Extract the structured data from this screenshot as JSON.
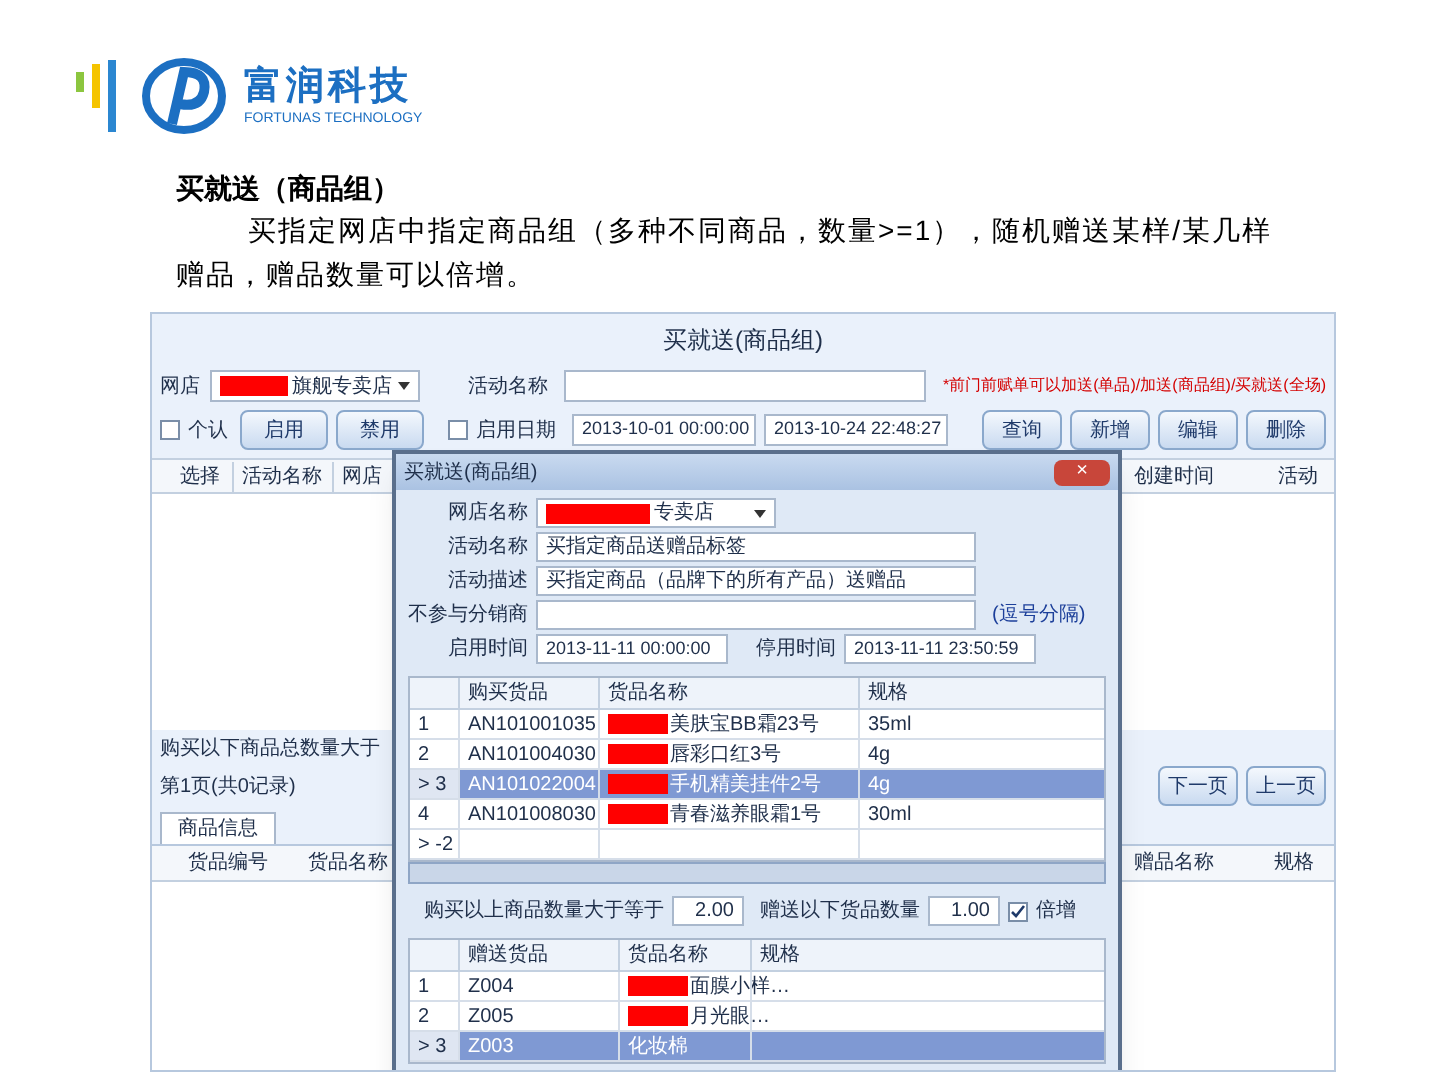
{
  "logo": {
    "name": "富润科技",
    "tagline": "FORTUNAS TECHNOLOGY"
  },
  "heading": "买就送（商品组）",
  "description": "买指定网店中指定商品组（多种不同商品，数量>=1），随机赠送某样/某几样赠品，赠品数量可以倍增。",
  "window": {
    "title": "买就送(商品组)",
    "shop_label": "网店",
    "shop_value": "旗舰专卖店",
    "shop_redacted": true,
    "name_label": "活动名称",
    "note": "*前门前赋单可以加送(单品)/加送(商品组)/买就送(全场)",
    "default_checkbox": {
      "label": "个认",
      "checked": false
    },
    "enable_button": "启用",
    "disable_button": "禁用",
    "date_checkbox": {
      "label": "启用日期",
      "checked": false
    },
    "date_from": "2013-10-01 00:00:00",
    "date_to": "2013-10-24 22:48:27",
    "buttons": [
      "查询",
      "新增",
      "编辑",
      "删除"
    ],
    "columns": [
      "选择",
      "活动名称",
      "网店"
    ],
    "right_columns": [
      "创建时间",
      "活动"
    ],
    "summary": "购买以下商品总数量大于",
    "pager": "第1页(共0记录)",
    "pager_buttons": [
      "下一页",
      "上一页"
    ],
    "tab": {
      "label": "商品信息",
      "selected": true
    },
    "detail_columns": [
      "货品编号",
      "货品名称"
    ],
    "detail_right_columns": [
      "赠品名称",
      "规格"
    ]
  },
  "dialog": {
    "title": "买就送(商品组)",
    "close": "×",
    "fields": [
      {
        "label": "网店名称",
        "value": "专卖店",
        "redacted": true,
        "kind": "select"
      },
      {
        "label": "活动名称",
        "value": "买指定商品送赠品标签",
        "redacted": false,
        "kind": "input"
      },
      {
        "label": "活动描述",
        "value": "买指定商品（品牌下的所有产品）送赠品",
        "redacted": false,
        "kind": "input"
      },
      {
        "label": "不参与分销商",
        "redacted": false,
        "kind": "input",
        "hint": "(逗号分隔)"
      }
    ],
    "start_label": "启用时间",
    "start_value": "2013-11-11 00:00:00",
    "end_label": "停用时间",
    "end_value": "2013-11-11 23:50:59",
    "columns": [
      "购买货品",
      "货品名称",
      "规格"
    ],
    "rows": [
      {
        "index": "1",
        "code": "AN101001035",
        "name": "美肤宝BB霜23号",
        "spec": "35ml",
        "selected": false
      },
      {
        "index": "2",
        "code": "AN101004030",
        "name": "唇彩口红3号",
        "spec": "4g",
        "selected": false
      },
      {
        "index": "> 3",
        "code": "AN101022004",
        "name": "手机精美挂件2号",
        "spec": "4g",
        "selected": true
      },
      {
        "index": "4",
        "code": "AN101008030",
        "name": "青春滋养眼霜1号",
        "spec": "30ml",
        "selected": false
      },
      {
        "index": "> -2",
        "selected": false
      }
    ],
    "buy_label": "购买以上商品数量大于等于",
    "buy_value": "2.00",
    "gift_label": "赠送以下货品数量",
    "gift_value": "1.00",
    "multiply": {
      "label": "倍增",
      "checked": true
    },
    "gift_columns": [
      "赠送货品",
      "货品名称",
      "规格"
    ],
    "gift_rows": [
      {
        "index": "1",
        "code": "Z004",
        "name": "面膜小样…",
        "selected": false
      },
      {
        "index": "2",
        "code": "Z005",
        "name": "月光眼…",
        "selected": false
      },
      {
        "index": "> 3",
        "code": "Z003",
        "name": "化妆棉",
        "selected": true
      }
    ]
  }
}
